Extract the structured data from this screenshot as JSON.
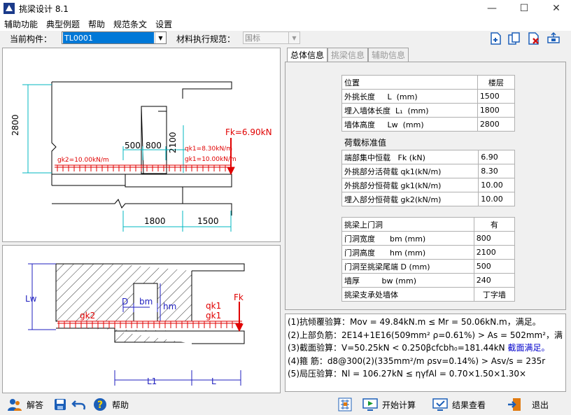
{
  "window": {
    "title": "挑梁设计 8.1",
    "minimize": "—",
    "maximize": "☐",
    "close": "✕"
  },
  "menu": [
    "辅助功能",
    "典型例题",
    "帮助",
    "规范条文",
    "设置"
  ],
  "toolbar": {
    "member_label": "当前构件：",
    "member_value": "TL0001",
    "code_label": "材料执行规范：",
    "code_value": "国标",
    "icons": [
      "new-doc-icon",
      "copy-doc-icon",
      "delete-doc-icon",
      "export-icon"
    ]
  },
  "tabs": [
    "总体信息",
    "挑梁信息",
    "辅助信息"
  ],
  "position_table": {
    "header": [
      "位置",
      "楼层"
    ],
    "rows": [
      [
        "外挑长度",
        "L",
        "(mm)",
        "1500"
      ],
      [
        "埋入墙体长度",
        "L₁",
        "(mm)",
        "1800"
      ],
      [
        "墙体高度",
        "Lw",
        "(mm)",
        "2800"
      ]
    ]
  },
  "load_section": "荷载标准值",
  "load_table": {
    "rows": [
      [
        "端部集中恒载",
        "Fk",
        "(kN)",
        "6.90"
      ],
      [
        "外挑部分活荷载",
        "qk1",
        "(kN/m)",
        "8.30"
      ],
      [
        "外挑部分恒荷载",
        "gk1",
        "(kN/m)",
        "10.00"
      ],
      [
        "埋入部分恒荷载",
        "gk2",
        "(kN/m)",
        "10.00"
      ]
    ]
  },
  "door_table": {
    "header": [
      "挑梁上门洞",
      "有"
    ],
    "rows": [
      [
        "门洞宽度",
        "bm",
        "(mm)",
        "800"
      ],
      [
        "门洞高度",
        "hm",
        "(mm)",
        "2100"
      ],
      [
        "门洞至挑梁尾端",
        "D",
        "(mm)",
        "500"
      ],
      [
        "墙厚",
        "bw",
        "(mm)",
        "240"
      ],
      [
        "挑梁支承处墙体",
        "",
        "",
        "丁字墙"
      ]
    ]
  },
  "results": [
    "(1)抗倾覆验算：Mov = 49.84kN.m ≤ Mr = 50.06kN.m，满足。",
    "(2)上部负筋：2E14+1E16(509mm² ρ=0.61%) > As = 502mm²，满",
    "(3)截面验算：V=50.25kN < 0.250βcfcbh₀=181.44kN ",
    "截面满足。",
    "(4)箍    筋：d8@300(2)(335mm²/m ρsv=0.14%) > Asv/s = 235r",
    "(5)局压验算：Nl = 106.27kN ≤ ηγfAl = 0.70×1.50×1.30×"
  ],
  "drawing_top": {
    "h": "2800",
    "w1": "500",
    "w2": "800",
    "h2": "2100",
    "fk": "Fk=6.90kN",
    "qk1": "qk1=8.30kN/m",
    "gk1": "gk1=10.00kN/m",
    "gk2": "gk2=10.00kN/m",
    "L1": "1800",
    "L": "1500"
  },
  "drawing_bottom": {
    "lw": "Lw",
    "d": "D",
    "bm": "bm",
    "hm": "hm",
    "gk2": "gk2",
    "qk1": "qk1",
    "gk1": "gk1",
    "fk": "Fk",
    "l1": "L1",
    "l": "L"
  },
  "status": {
    "answer": "解答",
    "help": "帮助",
    "start": "开始计算",
    "view": "结果查看",
    "exit": "退出"
  }
}
